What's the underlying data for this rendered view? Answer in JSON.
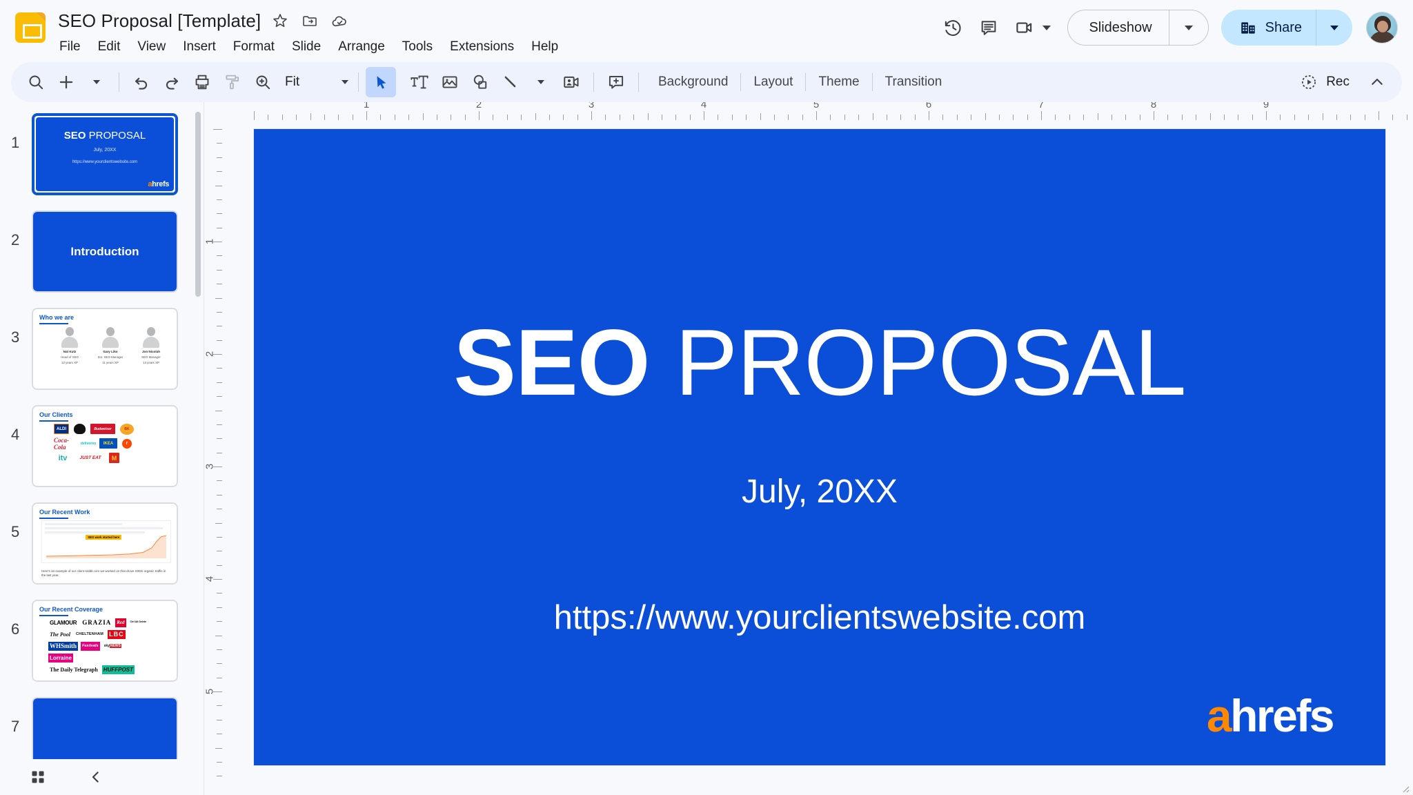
{
  "app": {
    "doc_title": "SEO Proposal [Template]",
    "doc_icon": "slides-file-icon"
  },
  "header": {
    "icons": [
      {
        "name": "star-icon",
        "title": "Star"
      },
      {
        "name": "move-to-folder-icon",
        "title": "Move"
      },
      {
        "name": "cloud-saved-icon",
        "title": "Saved to Drive"
      }
    ],
    "menus": [
      "File",
      "Edit",
      "View",
      "Insert",
      "Format",
      "Slide",
      "Arrange",
      "Tools",
      "Extensions",
      "Help"
    ],
    "right_icons": [
      {
        "name": "version-history-icon",
        "title": "Version history"
      },
      {
        "name": "comment-history-icon",
        "title": "Open comment history"
      },
      {
        "name": "meet-camera-icon",
        "title": "Join a call"
      }
    ],
    "slideshow_label": "Slideshow",
    "share_label": "Share",
    "avatar_name": "user-avatar"
  },
  "toolbar": {
    "zoom_label": "Fit",
    "text_buttons": [
      "Background",
      "Layout",
      "Theme",
      "Transition"
    ],
    "rec_label": "Rec",
    "icons": [
      {
        "name": "search-icon"
      },
      {
        "name": "new-slide-icon"
      },
      {
        "name": "undo-icon"
      },
      {
        "name": "redo-icon"
      },
      {
        "name": "print-icon"
      },
      {
        "name": "paint-format-icon"
      },
      {
        "name": "zoom-icon"
      },
      {
        "name": "select-cursor-icon"
      },
      {
        "name": "text-box-icon"
      },
      {
        "name": "insert-image-icon"
      },
      {
        "name": "shape-icon"
      },
      {
        "name": "line-icon"
      },
      {
        "name": "insert-video-icon"
      },
      {
        "name": "add-comment-icon"
      }
    ]
  },
  "filmstrip": {
    "bottom_icons": [
      {
        "name": "grid-view-icon"
      },
      {
        "name": "collapse-filmstrip-icon"
      }
    ],
    "slides": [
      {
        "number": "1",
        "selected": true,
        "type": "title",
        "title_bold": "SEO",
        "title_rest": " PROPOSAL",
        "date": "July, 20XX",
        "url": "https://www.yourclientswebsite.com",
        "logo_a": "a",
        "logo_rest": "hrefs"
      },
      {
        "number": "2",
        "selected": false,
        "type": "section",
        "heading": "Introduction"
      },
      {
        "number": "3",
        "selected": false,
        "type": "team",
        "heading": "Who we are",
        "members": [
          {
            "name": "Nat Kutz",
            "role": "Head of SEO",
            "xp": "12 years XP"
          },
          {
            "name": "Gary Liko",
            "role": "Snr. SEO Manager",
            "xp": "11 years XP"
          },
          {
            "name": "Jon Nicolah",
            "role": "SEO Manager",
            "xp": "13 years XP"
          }
        ]
      },
      {
        "number": "4",
        "selected": false,
        "type": "clients",
        "heading": "Our Clients",
        "logos": [
          [
            "ALDI",
            "AB",
            "Budweiser",
            "BURGER KING"
          ],
          [
            "Coca-Cola",
            "deliveroo",
            "IKEA",
            "reddit"
          ],
          [
            "itv",
            "JUST EAT",
            "M"
          ]
        ]
      },
      {
        "number": "5",
        "selected": false,
        "type": "work",
        "heading": "Our Recent Work",
        "chart_badge": "SEO work started here",
        "caption": "Here's an example of our client reddit.com we worked on that drove X00m organic traffic in the last year."
      },
      {
        "number": "6",
        "selected": false,
        "type": "press",
        "heading": "Our Recent Coverage",
        "outlets": [
          [
            "GLAMOUR",
            "GRAZIA",
            "Red",
            "Ctrl Alt Delete"
          ],
          [
            "The Pool",
            "CHELTENHAM",
            "Festivals",
            "LBC"
          ],
          [
            "WHSmith",
            "Lorraine",
            "sky NEWS"
          ],
          [
            "The Daily Telegraph",
            "HUFFPOST"
          ]
        ]
      },
      {
        "number": "7",
        "selected": false,
        "type": "section",
        "heading": ""
      }
    ]
  },
  "ruler": {
    "horizontal": [
      "1",
      "2",
      "3",
      "4",
      "5",
      "6",
      "7",
      "8",
      "9"
    ],
    "vertical": [
      "1",
      "2",
      "3",
      "4",
      "5"
    ]
  },
  "slide": {
    "background_color": "#0b4fd8",
    "title_bold": "SEO",
    "title_rest": " PROPOSAL",
    "date": "July, 20XX",
    "url": "https://www.yourclientswebsite.com",
    "logo_a": "a",
    "logo_rest": "hrefs",
    "logo_accent_color": "#ff8800"
  }
}
